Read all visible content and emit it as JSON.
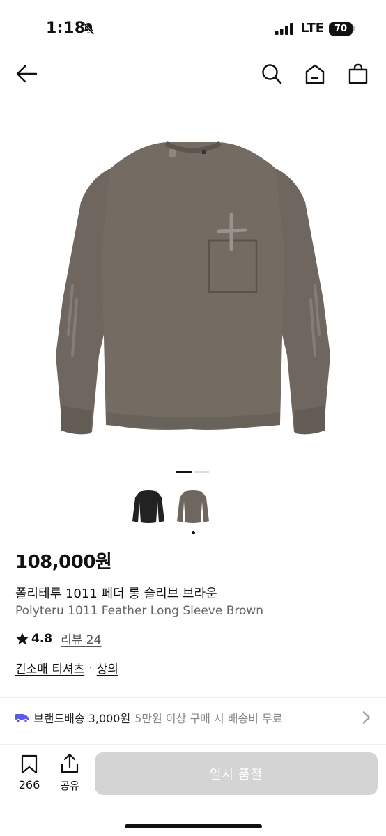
{
  "status_bar": {
    "time": "1:18",
    "network": "LTE",
    "battery": "70"
  },
  "nav": {
    "back_icon": "arrow-left",
    "search_icon": "magnifier",
    "home_icon": "house",
    "bag_icon": "shopping-bag"
  },
  "gallery": {
    "page_count": 2,
    "active_page": 1,
    "thumbnails": [
      {
        "color_name": "black",
        "color": "#222222"
      },
      {
        "color_name": "brown",
        "color": "#6f675f"
      }
    ],
    "selected_thumbnail": 2
  },
  "product": {
    "price": "108,000원",
    "name_ko": "폴리테루 1011 페더 롱 슬리브 브라운",
    "name_en": "Polyteru 1011 Feather Long Sleeve Brown",
    "rating": "4.8",
    "review_label": "리뷰 24",
    "category": "긴소매 티셔츠",
    "category_separator": "·",
    "category_parent": "상의"
  },
  "shipping": {
    "label": "브랜드배송 3,000원",
    "note": "5만원 이상 구매 시 배송비 무료"
  },
  "bottom_bar": {
    "save_count": "266",
    "share_label": "공유",
    "cta_label": "일시 품절"
  },
  "colors": {
    "shirt": "#6f675f",
    "accent_truck": "#5b5ce6",
    "cta_disabled": "#d4d4d4"
  }
}
